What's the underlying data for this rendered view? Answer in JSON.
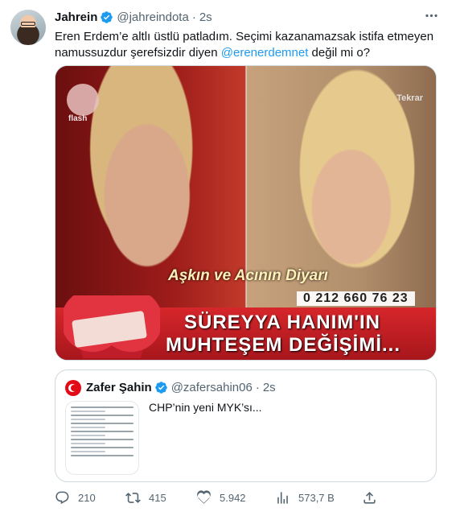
{
  "author": {
    "name": "Jahrein",
    "handle": "@jahreindota",
    "separator": "·",
    "time": "2s"
  },
  "tweet": {
    "text_before": "Eren Erdem’e altlı üstlü patladım. Seçimi kazanamazsak istifa etmeyen namussuzdur şerefsizdir diyen ",
    "mention": "@erenerdemnet",
    "text_after": " değil mi o?"
  },
  "media": {
    "channel_logo_text": "flash",
    "corner_text": "Tekrar",
    "show_title": "Aşkın ve Acının Diyarı",
    "phone_number": "0 212 660 76 23",
    "banner_line1": "SÜREYYA HANIM'IN",
    "banner_line2": "MUHTEŞEM DEĞİŞİMİ..."
  },
  "quote": {
    "name": "Zafer Şahin",
    "handle": "@zafersahin06",
    "separator": "·",
    "time": "2s",
    "text": "CHP’nin yeni MYK’sı..."
  },
  "actions": {
    "replies": "210",
    "retweets": "415",
    "likes": "5.942",
    "views": "573,7 B"
  },
  "colors": {
    "accent": "#1d9bf0",
    "muted": "#536471",
    "text": "#0f1419",
    "border": "#cfd9de"
  },
  "icons": {
    "verified": "verified-badge-icon",
    "more": "more-icon",
    "reply": "reply-icon",
    "retweet": "retweet-icon",
    "like": "heart-icon",
    "views": "views-chart-icon",
    "share": "share-icon"
  }
}
